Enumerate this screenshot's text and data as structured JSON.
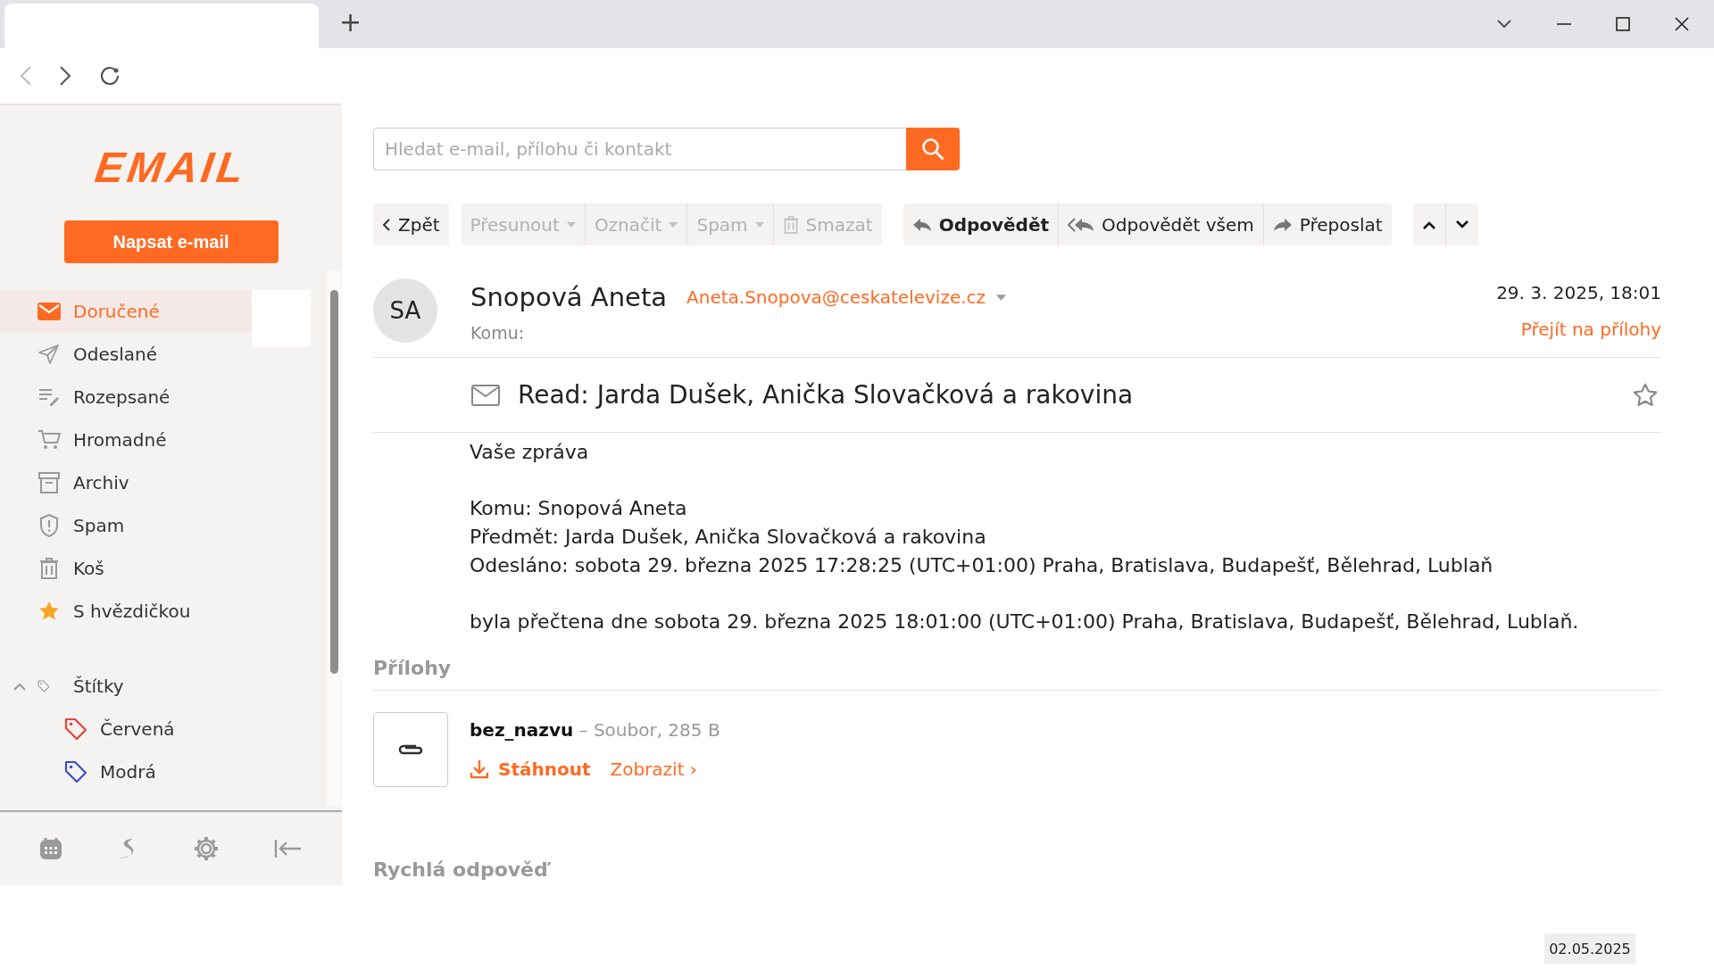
{
  "browser": {
    "new_tab": "+"
  },
  "sidebar": {
    "logo": "EMAIL",
    "compose": "Napsat e-mail",
    "folders": [
      {
        "label": "Doručené",
        "kind": "inbox",
        "selected": true
      },
      {
        "label": "Odeslané",
        "kind": "sent",
        "selected": false
      },
      {
        "label": "Rozepsané",
        "kind": "drafts",
        "selected": false
      },
      {
        "label": "Hromadné",
        "kind": "bulk",
        "selected": false
      },
      {
        "label": "Archiv",
        "kind": "archive",
        "selected": false
      },
      {
        "label": "Spam",
        "kind": "spam",
        "selected": false
      },
      {
        "label": "Koš",
        "kind": "trash",
        "selected": false
      },
      {
        "label": "S hvězdičkou",
        "kind": "starred",
        "selected": false
      }
    ],
    "labels": {
      "label": "Štítky",
      "expanded": true,
      "children": [
        {
          "label": "Červená",
          "color": "#e8413a"
        },
        {
          "label": "Modrá",
          "color": "#3a4fc0"
        }
      ]
    }
  },
  "search": {
    "placeholder": "Hledat e-mail, přílohu či kontakt"
  },
  "toolbar": [
    [
      {
        "label": "Zpět",
        "kind": "back",
        "disabled": false,
        "dropdown": false
      }
    ],
    [
      {
        "label": "Přesunout",
        "kind": "plain",
        "disabled": true,
        "dropdown": true
      },
      {
        "label": "Označit",
        "kind": "plain",
        "disabled": true,
        "dropdown": true
      },
      {
        "label": "Spam",
        "kind": "plain",
        "disabled": true,
        "dropdown": true
      },
      {
        "label": "Smazat",
        "kind": "trash",
        "disabled": true,
        "dropdown": false
      }
    ],
    [
      {
        "label": "Odpovědět",
        "kind": "reply",
        "disabled": false,
        "dropdown": false
      },
      {
        "label": "Odpovědět všem",
        "kind": "reply-all",
        "disabled": false,
        "dropdown": false
      },
      {
        "label": "Přeposlat",
        "kind": "forward",
        "disabled": false,
        "dropdown": false
      }
    ],
    [
      {
        "kind": "up",
        "disabled": false,
        "dropdown": false
      },
      {
        "kind": "down",
        "disabled": false,
        "dropdown": false
      }
    ]
  ],
  "message": {
    "avatar": "SA",
    "sender": "Snopová Aneta",
    "address": "Aneta.Snopova@ceskatelevize.cz",
    "to_label": "Komu:",
    "date": "29. 3. 2025, 18:01",
    "attachments_link": "Přejít na přílohy",
    "subject": "Read: Jarda Dušek, Anička Slovačková a rakovina",
    "starred": false,
    "body": [
      [
        "Vaše zpráva"
      ],
      [
        "Komu: Snopová Aneta",
        "Předmět: Jarda Dušek, Anička Slovačková a rakovina",
        "Odesláno: sobota 29. března 2025 17:28:25 (UTC+01:00) Praha, Bratislava, Budapešť, Bělehrad, Lublaň"
      ],
      [
        "byla přečtena dne sobota 29. března 2025 18:01:00 (UTC+01:00) Praha, Bratislava, Budapešť, Bělehrad, Lublaň."
      ]
    ]
  },
  "attachments": {
    "heading": "Přílohy",
    "items": [
      {
        "name": "bez_nazvu",
        "meta": "– Soubor, 285 B",
        "download": "Stáhnout",
        "view": "Zobrazit ›"
      }
    ]
  },
  "quick_reply": {
    "heading": "Rychlá odpověď"
  },
  "taskbar": {
    "date": "02.05.2025"
  }
}
